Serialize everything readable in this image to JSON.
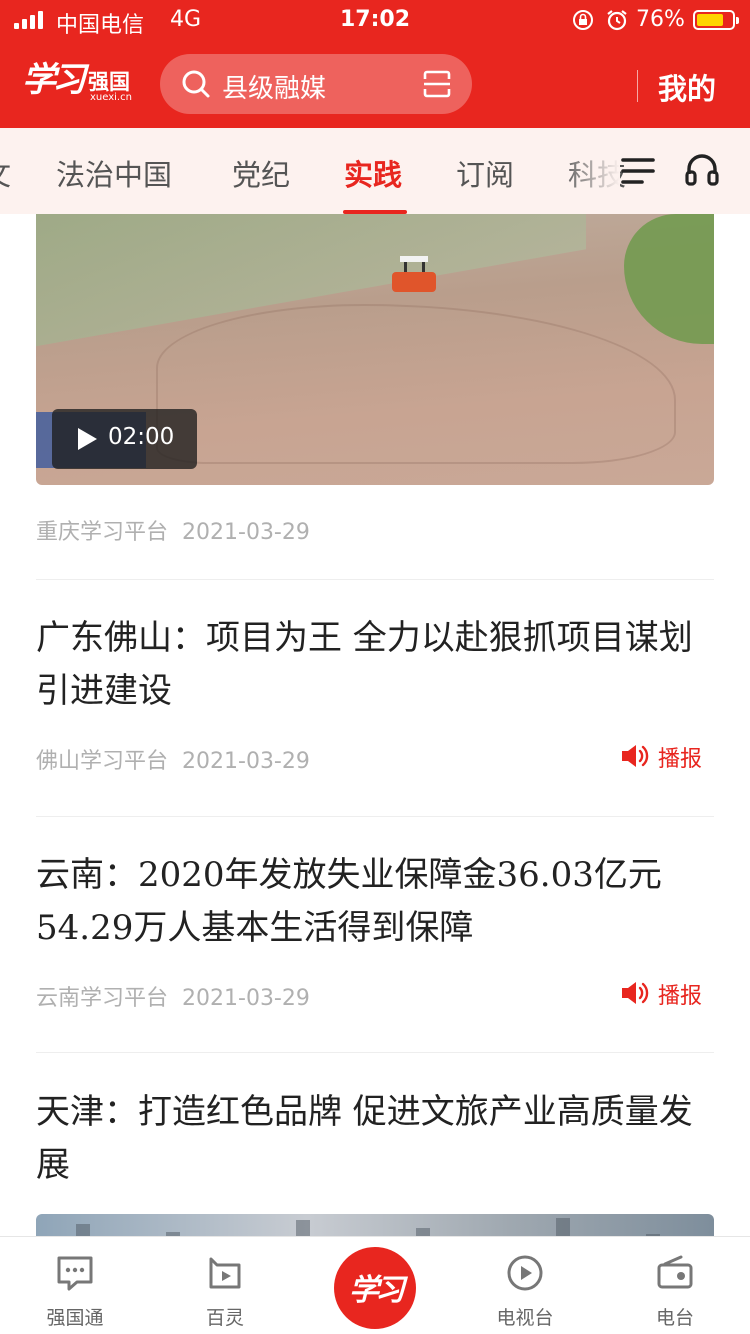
{
  "status_bar": {
    "carrier": "中国电信",
    "network": "4G",
    "time": "17:02",
    "battery_percent": "76%",
    "battery_level": 0.76
  },
  "header": {
    "logo_script": "学习",
    "logo_name": "强国",
    "logo_domain": "xuexi.cn",
    "search_placeholder": "县级融媒",
    "profile_label": "我的"
  },
  "tabs": {
    "partial_left": "文",
    "items": [
      "法治中国",
      "党纪",
      "实践",
      "订阅",
      "科技"
    ],
    "active_index": 2
  },
  "feed": {
    "video_item": {
      "duration": "02:00",
      "source": "重庆学习平台",
      "date": "2021-03-29"
    },
    "articles": [
      {
        "title": "广东佛山：项目为王 全力以赴狠抓项目谋划引进建设",
        "source": "佛山学习平台",
        "date": "2021-03-29",
        "broadcast_label": "播报"
      },
      {
        "title": "云南：2020年发放失业保障金36.03亿元 54.29万人基本生活得到保障",
        "source": "云南学习平台",
        "date": "2021-03-29",
        "broadcast_label": "播报"
      },
      {
        "title": "天津：打造红色品牌 促进文旅产业高质量发展"
      }
    ]
  },
  "bottom_nav": {
    "items": [
      "强国通",
      "百灵",
      "电视台",
      "电台"
    ],
    "center_logo": "学习"
  },
  "colors": {
    "brand_red": "#e8261f",
    "tab_bar_bg": "#fdf2ef",
    "meta_gray": "#b0b0b0"
  },
  "icons": [
    "signal-icon",
    "lock-rotation-icon",
    "alarm-icon",
    "battery-icon",
    "search-icon",
    "scan-icon",
    "menu-icon",
    "headset-icon",
    "play-icon",
    "speaker-icon",
    "chat-icon",
    "bailing-icon",
    "tv-play-icon",
    "radio-icon"
  ]
}
